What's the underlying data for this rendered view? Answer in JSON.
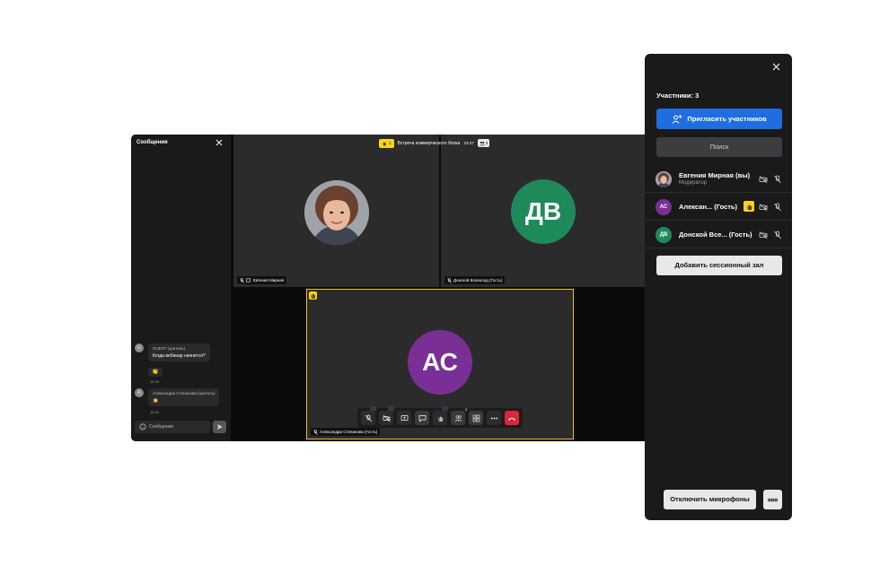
{
  "chat": {
    "title": "Сообщения",
    "messages": [
      {
        "avatar_letter": "G",
        "author": "GUEST (зритель)",
        "text": "Когда вебинар начнется?",
        "reaction": "👏",
        "time": "15:26"
      },
      {
        "avatar_letter": "А",
        "author": "Александра Степанова (зритель)",
        "reaction": "👏",
        "time": "15:26"
      }
    ],
    "input_placeholder": "Сообщение"
  },
  "meeting": {
    "hand_count": "1",
    "title": "Встреча коммерческого блока",
    "time": "23:37",
    "participants_count": "3"
  },
  "tiles": [
    {
      "name": "Евгения Мирная"
    },
    {
      "name": "Донской Всеволод (Гость)",
      "initials": "ДВ",
      "color": "#1e8a5a"
    },
    {
      "name": "Александра Степанова (Гость)",
      "initials": "АС",
      "color": "#7a2f96",
      "highlight": "#f0c020"
    }
  ],
  "controls": {
    "icons": [
      "mic-off-icon",
      "camera-off-icon",
      "screen-share-icon",
      "chat-icon",
      "raise-hand-icon",
      "participants-icon",
      "grid-icon",
      "more-icon",
      "hang-up-icon"
    ],
    "participants_badge": "3"
  },
  "panel": {
    "count_label": "Участники: 3",
    "invite_label": "Пригласить участников",
    "search_placeholder": "Поиск",
    "participants": [
      {
        "name": "Евгения Мирная (вы)",
        "role": "Модератор"
      },
      {
        "name": "Алексан... (Гость)",
        "initials": "АС",
        "color": "#7a2f96",
        "hand_raised": true
      },
      {
        "name": "Донской Все... (Гость)",
        "initials": "ДВ",
        "color": "#1e8a5a"
      }
    ],
    "add_room_label": "Добавить сессионный зал",
    "mute_all_label": "Отключить микрофоны"
  },
  "colors": {
    "accent_blue": "#1f6de0",
    "hand_yellow": "#ffd21f",
    "hangup_red": "#e0243a"
  }
}
